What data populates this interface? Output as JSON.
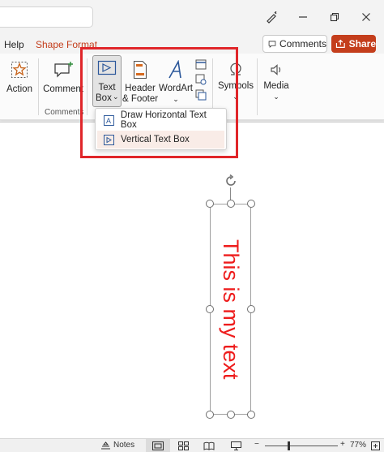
{
  "tabs": [
    {
      "label": "Help",
      "contextual": false
    },
    {
      "label": "Shape Format",
      "contextual": true
    }
  ],
  "header": {
    "comments_label": "Comments",
    "share_label": "Share"
  },
  "ribbon": {
    "action_label": "Action",
    "comment_label": "Comment",
    "comments_group_label": "Comments",
    "textbox_line1": "Text",
    "textbox_line2": "Box",
    "header_footer_line1": "Header",
    "header_footer_line2": "& Footer",
    "wordart_label": "WordArt",
    "symbols_label": "Symbols",
    "media_label": "Media"
  },
  "dropdown": {
    "items": [
      {
        "label": "Draw Horizontal Text Box",
        "highlighted": false
      },
      {
        "label": "Vertical Text Box",
        "highlighted": true
      }
    ]
  },
  "slide": {
    "text": "This is my text",
    "text_color": "#ee1c1c"
  },
  "status": {
    "notes_label": "Notes",
    "zoom": "77%"
  },
  "colors": {
    "accent": "#c43e1c",
    "highlight_frame": "#e0262a"
  }
}
